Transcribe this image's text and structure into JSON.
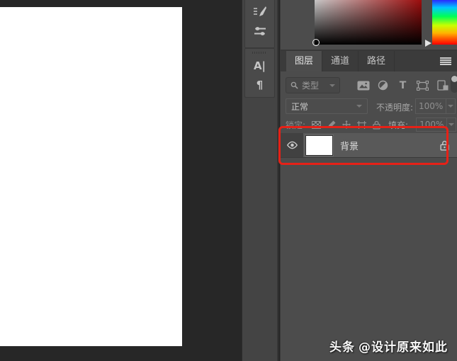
{
  "colors": {
    "annotation_red": "#e62117",
    "panel_bg": "#4c4c4c",
    "pasteboard": "#272727",
    "layer_selected": "#595959",
    "hue_selected": "red"
  },
  "dock": {
    "character_panel_glyph": "A|",
    "paragraph_panel_glyph": "¶"
  },
  "panel": {
    "tabs": {
      "items": [
        {
          "label": "图层",
          "active": true
        },
        {
          "label": "通道",
          "active": false
        },
        {
          "label": "路径",
          "active": false
        }
      ]
    },
    "filter": {
      "search_label": "类型",
      "type_filter_glyph": "T"
    },
    "blend": {
      "mode": "正常",
      "opacity_label": "不透明度:",
      "opacity_value": "100%"
    },
    "lock": {
      "label": "锁定:",
      "fill_label": "填充:",
      "fill_value": "100%"
    },
    "layers": [
      {
        "name": "背景",
        "visible": true,
        "locked": true,
        "thumbnail_color": "#ffffff"
      }
    ]
  },
  "watermark": {
    "brand": "头条",
    "handle": "@设计原来如此"
  }
}
